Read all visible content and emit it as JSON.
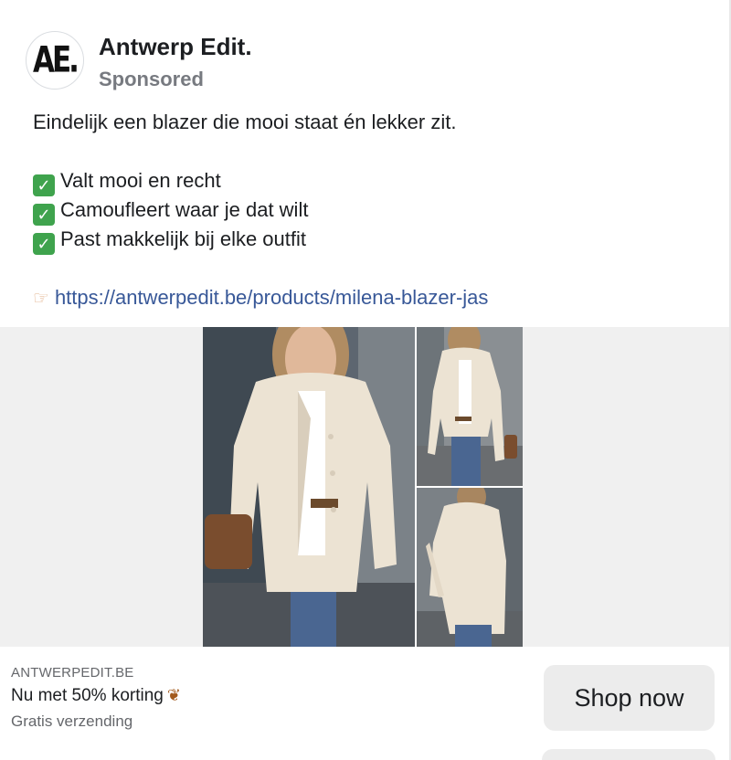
{
  "post": {
    "page_name": "Antwerp Edit.",
    "avatar_text": "AE.",
    "sponsored_label": "Sponsored"
  },
  "body": {
    "intro": "Eindelijk een blazer die mooi staat én lekker zit.",
    "bullets": [
      "Valt mooi en recht",
      "Camoufleert waar je dat wilt",
      "Past makkelijk bij elke outfit"
    ],
    "link": "https://antwerpedit.be/products/milena-blazer-jas",
    "icons": {
      "bullet": "check-mark-emoji",
      "link": "pointing-hand-emoji"
    }
  },
  "media": {
    "images": [
      "woman-cream-blazer-front",
      "woman-cream-blazer-full",
      "woman-cream-blazer-side"
    ]
  },
  "ad": {
    "domain": "ANTWERPEDIT.BE",
    "headline": "Nu met 50% korting",
    "headline_icon": "autumn-leaves-emoji",
    "description": "Gratis verzending",
    "cta_label": "Shop now"
  },
  "colors": {
    "link": "#385898",
    "secondary_text": "#65676b",
    "button_bg": "#ececec",
    "check_green": "#3fa34d"
  }
}
